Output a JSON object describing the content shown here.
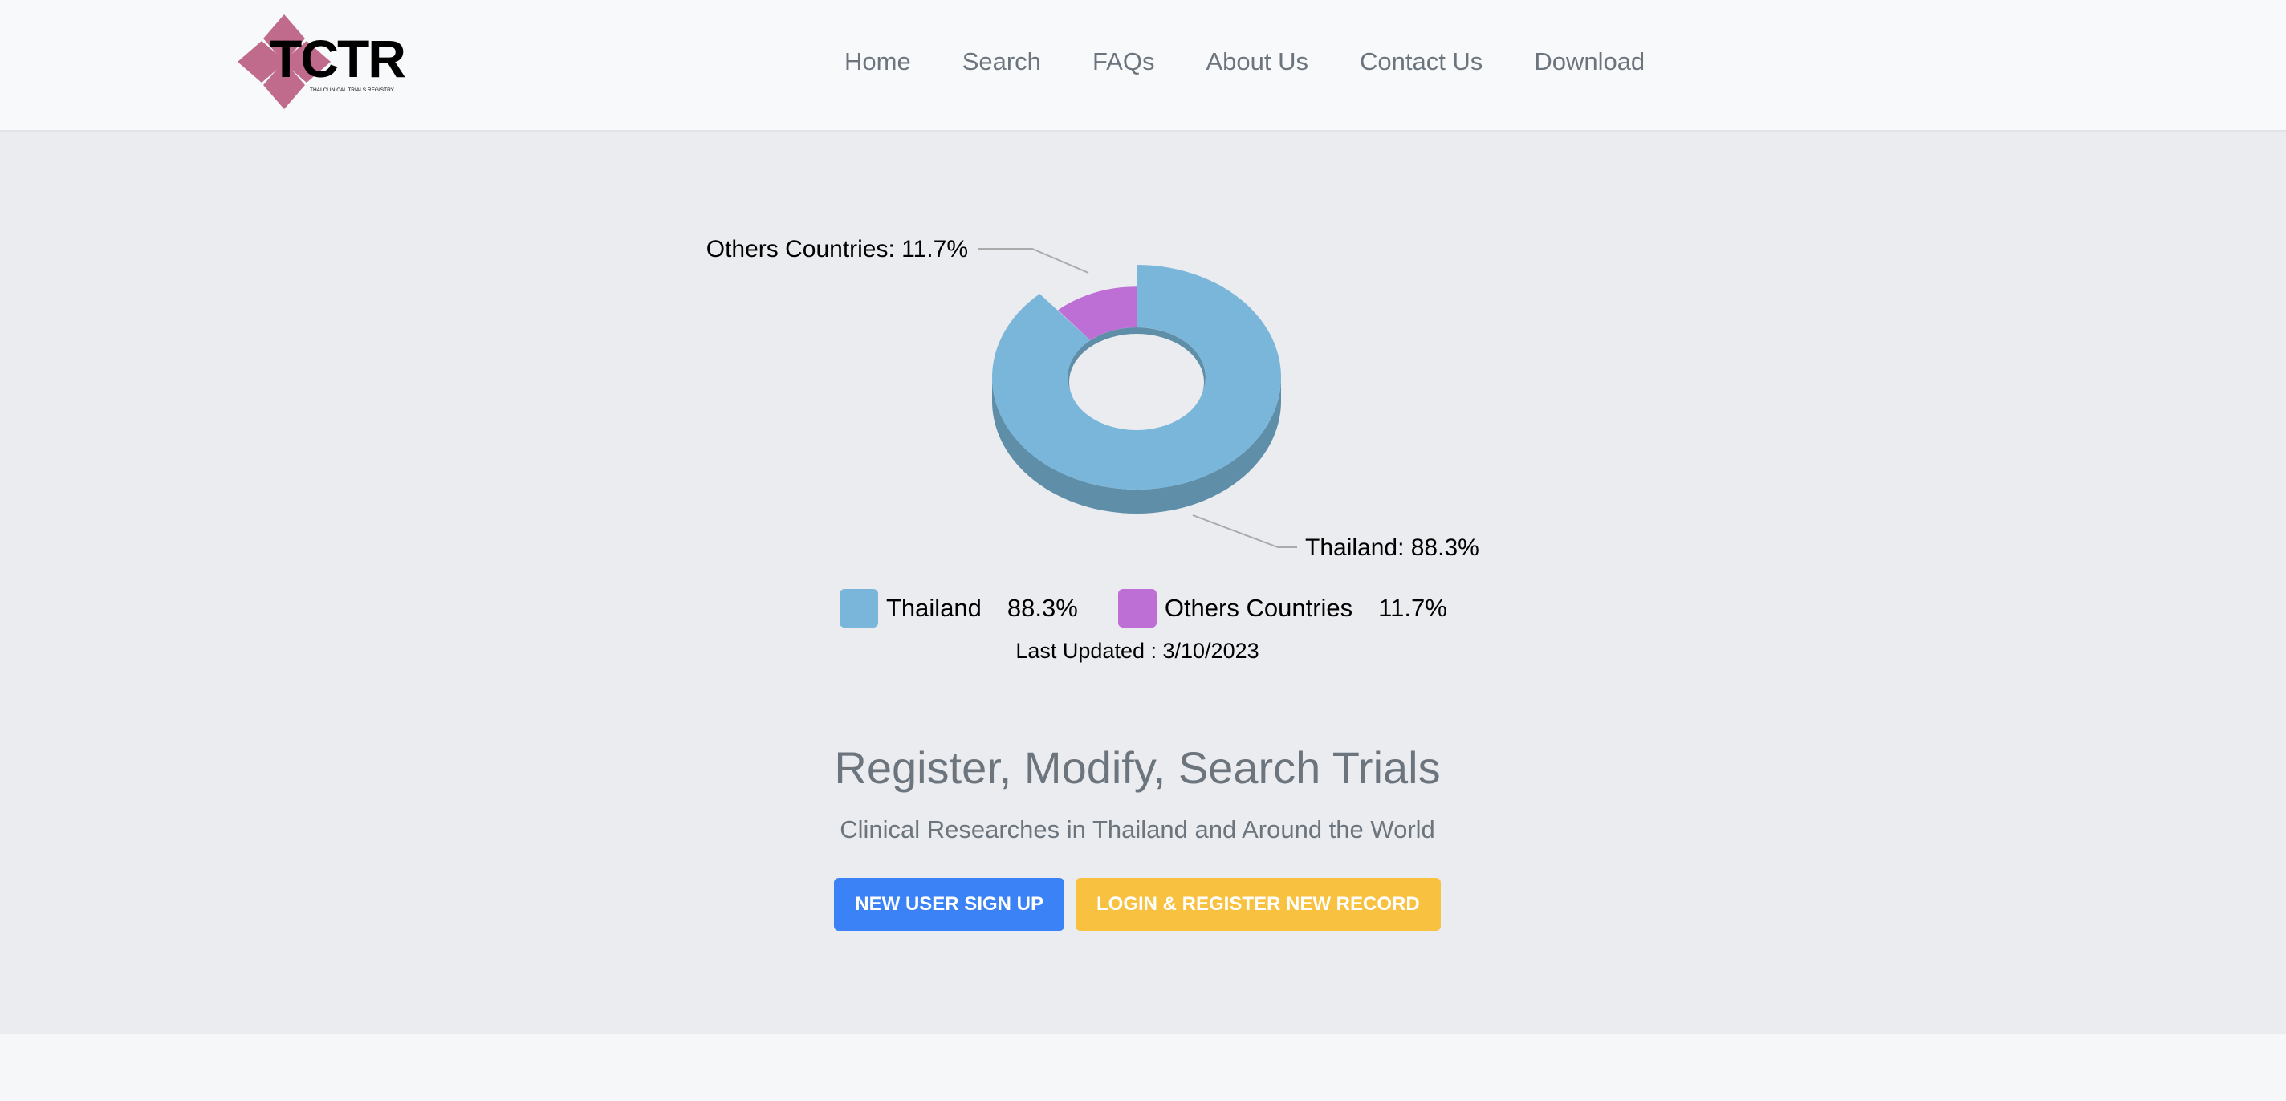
{
  "brand": {
    "logo_text": "TCTR",
    "logo_subtext": "THAI CLINICAL TRIALS REGISTRY"
  },
  "nav": {
    "items": [
      {
        "label": "Home"
      },
      {
        "label": "Search"
      },
      {
        "label": "FAQs"
      },
      {
        "label": "About Us"
      },
      {
        "label": "Contact Us"
      },
      {
        "label": "Download"
      }
    ]
  },
  "chart_data": {
    "type": "pie",
    "style": "3d-donut",
    "categories": [
      "Thailand",
      "Others Countries"
    ],
    "values": [
      88.3,
      11.7
    ],
    "colors": [
      "#7ab6d9",
      "#bd6fd6"
    ],
    "labels": [
      "Thailand: 88.3%",
      "Others Countries: 11.7%"
    ],
    "legend": [
      {
        "name": "Thailand",
        "value": "88.3%"
      },
      {
        "name": "Others Countries",
        "value": "11.7%"
      }
    ],
    "legend_position": "bottom"
  },
  "updated": "Last Updated : 3/10/2023",
  "hero": {
    "title": "Register, Modify, Search Trials",
    "subtitle": "Clinical Researches in Thailand and Around the World"
  },
  "buttons": {
    "signup": "NEW USER SIGN UP",
    "login": "LOGIN & REGISTER NEW RECORD"
  },
  "colors": {
    "accent_blue": "#3b82f6",
    "accent_yellow": "#f8c13f",
    "logo_pink": "#c06a8c"
  }
}
